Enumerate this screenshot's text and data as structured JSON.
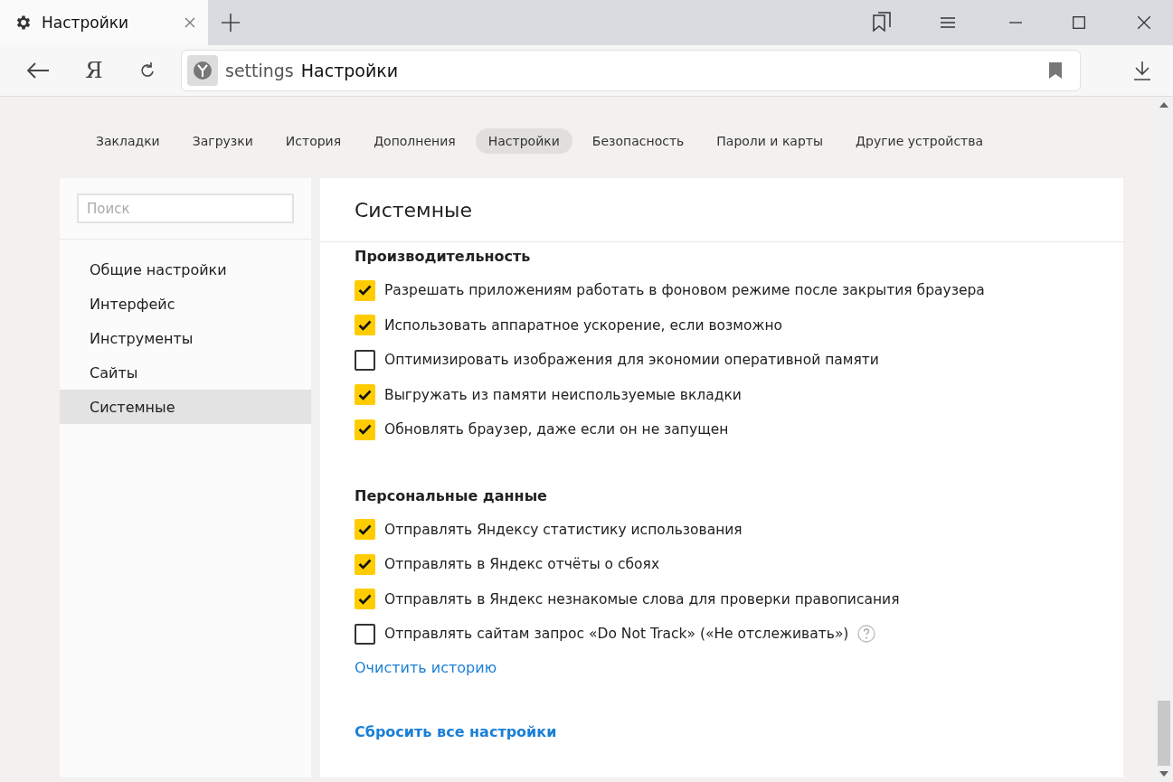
{
  "browser_tab": {
    "title": "Настройки"
  },
  "toolbar": {
    "logo_letter": "Я"
  },
  "address": {
    "scheme": "settings",
    "title": "Настройки"
  },
  "nav_tabs": [
    {
      "label": "Закладки",
      "selected": false
    },
    {
      "label": "Загрузки",
      "selected": false
    },
    {
      "label": "История",
      "selected": false
    },
    {
      "label": "Дополнения",
      "selected": false
    },
    {
      "label": "Настройки",
      "selected": true
    },
    {
      "label": "Безопасность",
      "selected": false
    },
    {
      "label": "Пароли и карты",
      "selected": false
    },
    {
      "label": "Другие устройства",
      "selected": false
    }
  ],
  "sidebar": {
    "search_placeholder": "Поиск",
    "items": [
      {
        "label": "Общие настройки",
        "selected": false
      },
      {
        "label": "Интерфейс",
        "selected": false
      },
      {
        "label": "Инструменты",
        "selected": false
      },
      {
        "label": "Сайты",
        "selected": false
      },
      {
        "label": "Системные",
        "selected": true
      }
    ]
  },
  "panel": {
    "title": "Системные",
    "sections": [
      {
        "heading": "Производительность",
        "options": [
          {
            "label": "Разрешать приложениям работать в фоновом режиме после закрытия браузера",
            "checked": true,
            "help": false
          },
          {
            "label": "Использовать аппаратное ускорение, если возможно",
            "checked": true,
            "help": false
          },
          {
            "label": "Оптимизировать изображения для экономии оперативной памяти",
            "checked": false,
            "help": false
          },
          {
            "label": "Выгружать из памяти неиспользуемые вкладки",
            "checked": true,
            "help": false
          },
          {
            "label": "Обновлять браузер, даже если он не запущен",
            "checked": true,
            "help": false
          }
        ]
      },
      {
        "heading": "Персональные данные",
        "options": [
          {
            "label": "Отправлять Яндексу статистику использования",
            "checked": true,
            "help": false
          },
          {
            "label": "Отправлять в Яндекс отчёты о сбоях",
            "checked": true,
            "help": false
          },
          {
            "label": "Отправлять в Яндекс незнакомые слова для проверки правописания",
            "checked": true,
            "help": false
          },
          {
            "label": "Отправлять сайтам запрос «Do Not Track» («Не отслеживать»)",
            "checked": false,
            "help": true
          }
        ],
        "link": "Очистить историю"
      }
    ],
    "reset_link": "Сбросить все настройки"
  }
}
